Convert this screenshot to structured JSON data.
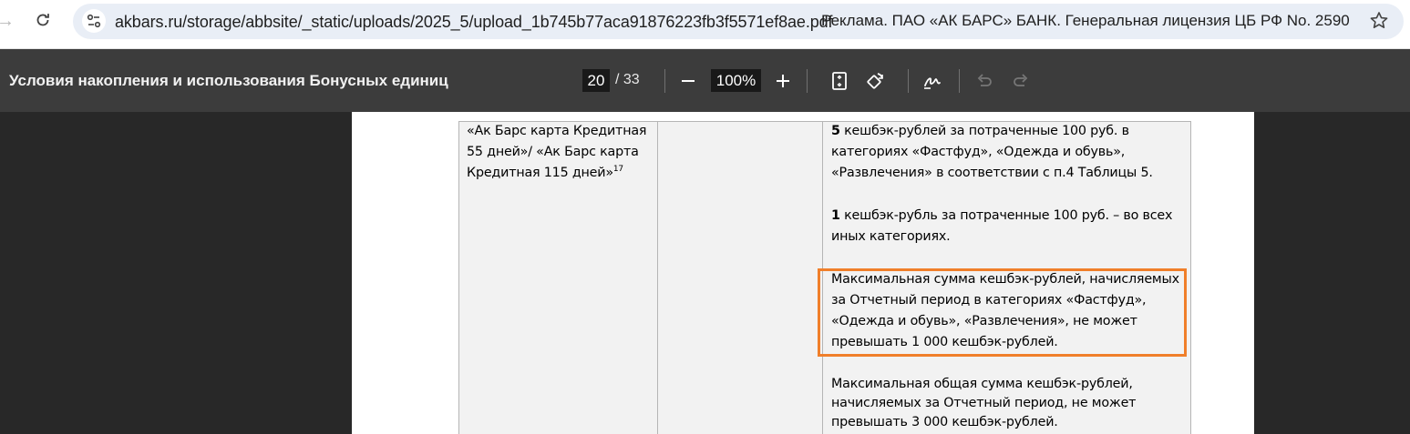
{
  "browser": {
    "url": "akbars.ru/storage/abbsite/_static/uploads/2025_5/upload_1b745b77aca91876223fb3f5571ef8ae.pdf",
    "url_overlay": "Реклама. ПАО «АК БАРС» БАНК. Генеральная лицензия ЦБ РФ No. 2590"
  },
  "toolbar": {
    "title": "Условия накопления и использования Бонусных единиц",
    "page_current": "20",
    "page_total": "/ 33",
    "zoom": "100%"
  },
  "table": {
    "col1_lines": [
      "«Ак Барс карта Кредитная",
      "55 дней»/ «Ак Барс карта",
      "Кредитная 115 дней»"
    ],
    "col1_footnote": "17",
    "p1_bold": "5",
    "p1_lines": [
      " кешбэк-рублей за потраченные 100 руб. в",
      "категориях «Фастфуд», «Одежда и обувь»,",
      "«Развлечения» в соответствии с п.4 Таблицы 5."
    ],
    "p2_bold": "1",
    "p2_lines": [
      " кешбэк-рубль за потраченные 100 руб. – во всех",
      "иных категориях."
    ],
    "p3_lines": [
      "Максимальная сумма кешбэк-рублей, начисляемых",
      "за Отчетный период в категориях «Фастфуд»,",
      "«Одежда и обувь», «Развлечения», не может",
      "превышать 1 000 кешбэк-рублей."
    ],
    "p4_lines": [
      "Максимальная общая сумма кешбэк-рублей,",
      "начисляемых за Отчетный период, не может",
      "превышать 3 000 кешбэк-рублей."
    ]
  },
  "colors": {
    "highlight": "#f07f2a",
    "toolbar_bg": "#3c3c3c",
    "viewer_bg": "#282828"
  }
}
